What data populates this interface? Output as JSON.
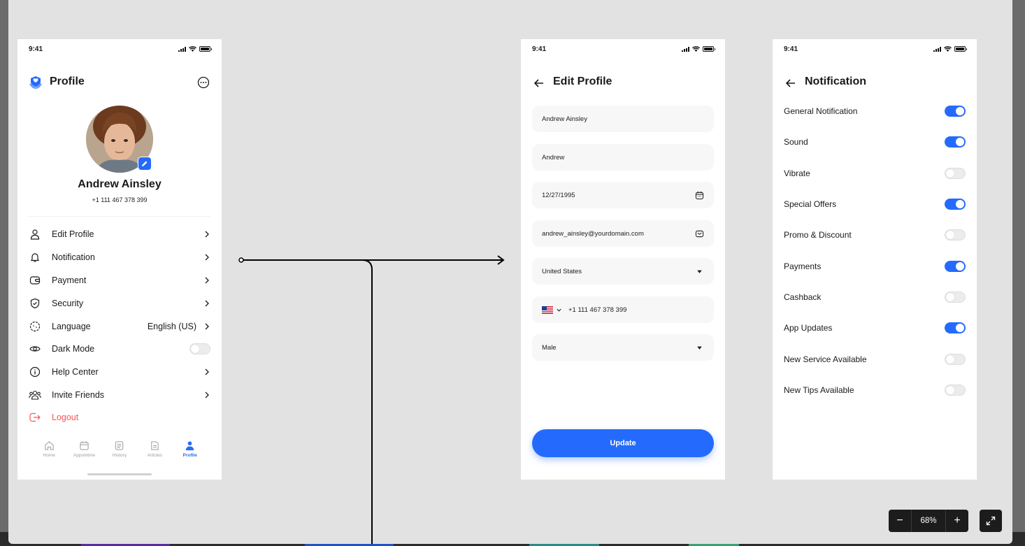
{
  "colors": {
    "accent": "#246bfd",
    "danger": "#f75555",
    "canvas": "#e2e2e2"
  },
  "profile_screen": {
    "time": "9:41",
    "title": "Profile",
    "name": "Andrew Ainsley",
    "phone": "+1 111 467 378 399",
    "menu": [
      {
        "label": "Edit Profile",
        "icon": "user-icon"
      },
      {
        "label": "Notification",
        "icon": "bell-icon"
      },
      {
        "label": "Payment",
        "icon": "wallet-icon"
      },
      {
        "label": "Security",
        "icon": "shield-icon"
      },
      {
        "label": "Language",
        "value": "English (US)",
        "icon": "language-icon"
      },
      {
        "label": "Dark Mode",
        "icon": "eye-icon",
        "toggle": false
      },
      {
        "label": "Help Center",
        "icon": "info-icon"
      },
      {
        "label": "Invite Friends",
        "icon": "people-icon"
      },
      {
        "label": "Logout",
        "icon": "logout-icon"
      }
    ],
    "nav": [
      {
        "label": "Home",
        "icon": "home-icon"
      },
      {
        "label": "Appointme",
        "icon": "calendar-icon"
      },
      {
        "label": "History",
        "icon": "history-icon"
      },
      {
        "label": "Articles",
        "icon": "articles-icon"
      },
      {
        "label": "Profile",
        "icon": "profile-icon",
        "active": true
      }
    ]
  },
  "edit_screen": {
    "time": "9:41",
    "title": "Edit Profile",
    "fields": {
      "full_name": "Andrew Ainsley",
      "nickname": "Andrew",
      "dob": "12/27/1995",
      "email": "andrew_ainsley@yourdomain.com",
      "country": "United States",
      "phone": "+1 111 467 378 399",
      "gender": "Male"
    },
    "update_label": "Update"
  },
  "notification_screen": {
    "time": "9:41",
    "title": "Notification",
    "items": [
      {
        "label": "General Notification",
        "on": true
      },
      {
        "label": "Sound",
        "on": true
      },
      {
        "label": "Vibrate",
        "on": false
      },
      {
        "label": "Special Offers",
        "on": true
      },
      {
        "label": "Promo & Discount",
        "on": false
      },
      {
        "label": "Payments",
        "on": true
      },
      {
        "label": "Cashback",
        "on": false
      },
      {
        "label": "App Updates",
        "on": true
      },
      {
        "label": "New Service Available",
        "on": false
      },
      {
        "label": "New Tips Available",
        "on": false
      }
    ]
  },
  "zoom": {
    "value": "68%",
    "minus": "−",
    "plus": "+"
  }
}
